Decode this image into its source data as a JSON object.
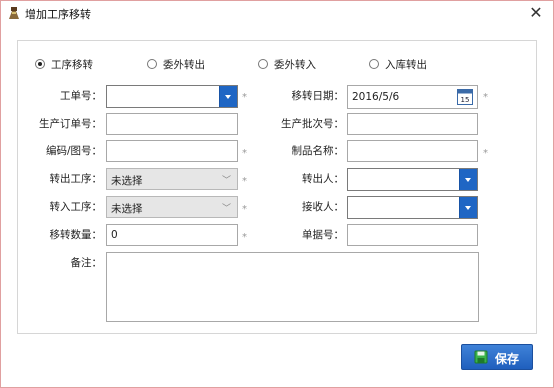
{
  "window": {
    "title": "增加工序移转",
    "close_symbol": "✕"
  },
  "radio_options": [
    {
      "label": "工序移转",
      "checked": true
    },
    {
      "label": "委外转出",
      "checked": false
    },
    {
      "label": "委外转入",
      "checked": false
    },
    {
      "label": "入库转出",
      "checked": false
    }
  ],
  "form": {
    "work_order": {
      "label": "工单号：",
      "value": ""
    },
    "transfer_date": {
      "label": "移转日期：",
      "value": "2016/5/6",
      "calendar_day": "15"
    },
    "production_order": {
      "label": "生产订单号：",
      "value": ""
    },
    "production_batch": {
      "label": "生产批次号：",
      "value": ""
    },
    "code_drawing": {
      "label": "编码/图号：",
      "value": ""
    },
    "product_name": {
      "label": "制品名称：",
      "value": ""
    },
    "out_process": {
      "label": "转出工序：",
      "value": "未选择"
    },
    "out_person": {
      "label": "转出人：",
      "value": ""
    },
    "in_process": {
      "label": "转入工序：",
      "value": "未选择"
    },
    "receiver": {
      "label": "接收人：",
      "value": ""
    },
    "quantity": {
      "label": "移转数量：",
      "value": "0"
    },
    "document_no": {
      "label": "单据号：",
      "value": ""
    },
    "remarks": {
      "label": "备注：",
      "value": ""
    }
  },
  "required_mark": "*",
  "save_button": {
    "label": "保存"
  },
  "colors": {
    "accent": "#1f66c4",
    "border": "#a8a8a8"
  }
}
